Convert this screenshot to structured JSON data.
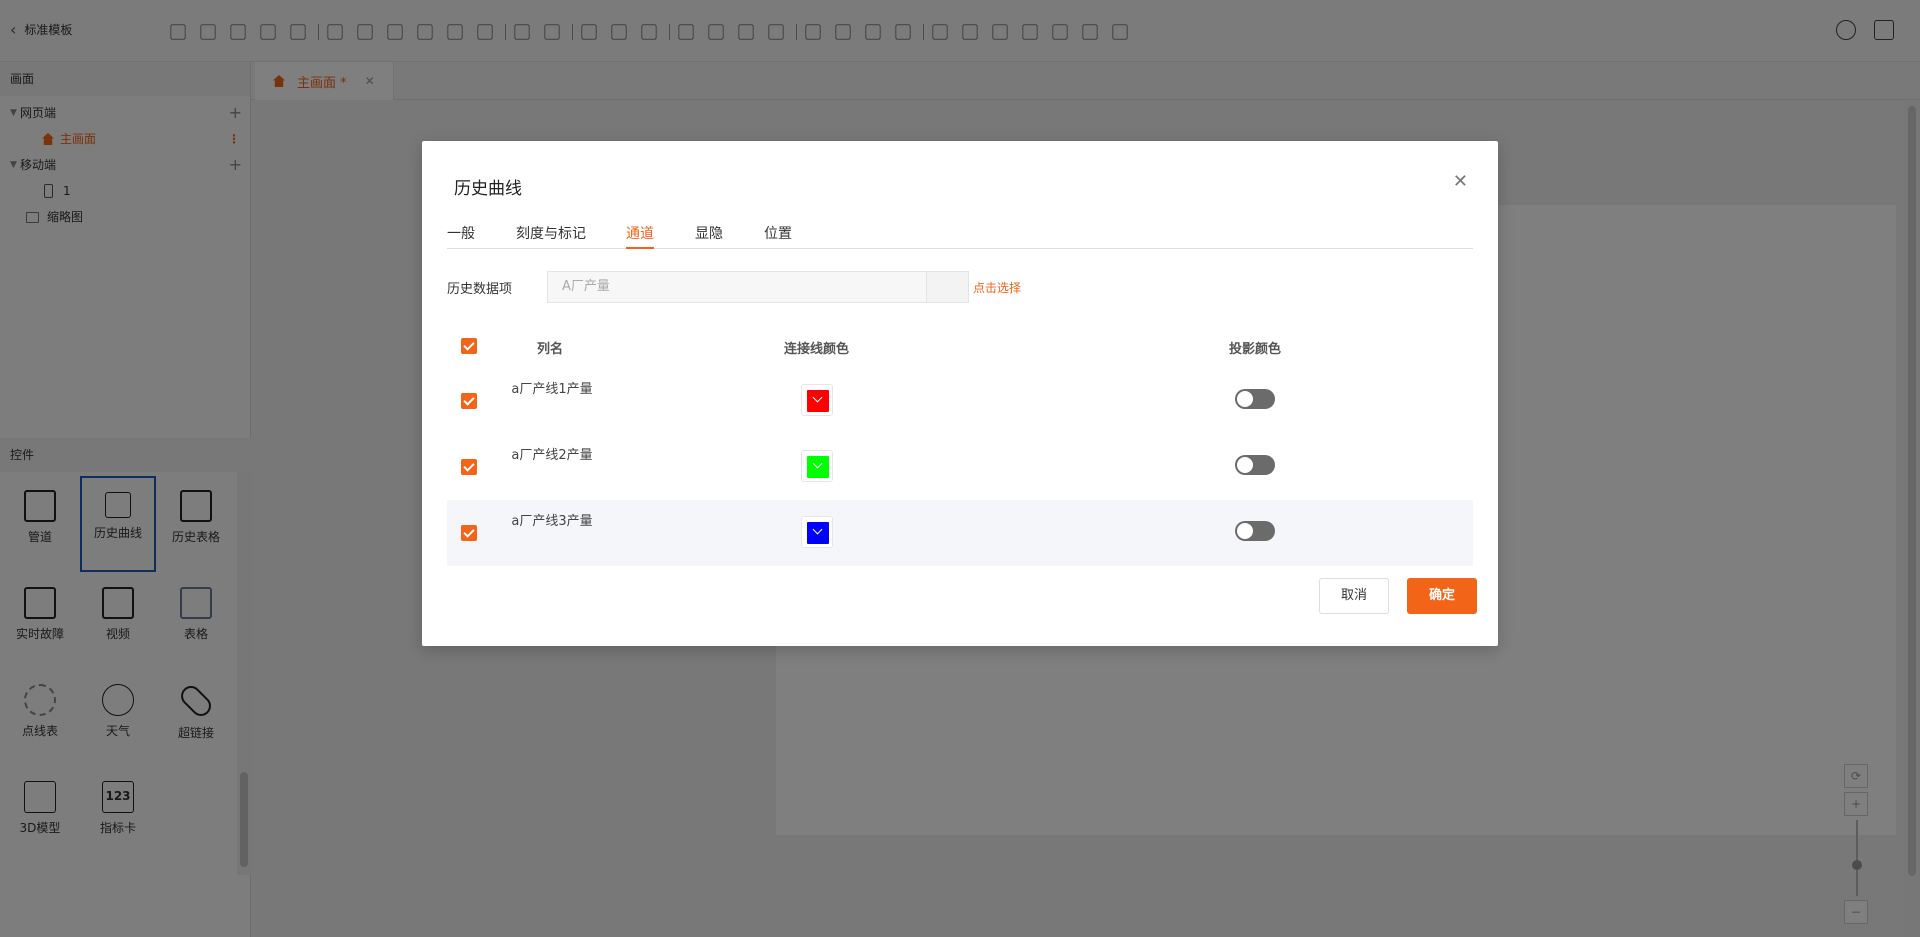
{
  "app": {
    "back_label": "标准模板"
  },
  "left_panel": {
    "pages_title": "画面",
    "tree": {
      "web_group": "网页端",
      "main_page": "主画面",
      "mobile_group": "移动端",
      "mobile_item": "1",
      "thumbnail": "缩略图"
    },
    "controls_title": "控件",
    "controls": [
      {
        "label": "管道",
        "icon": "pipe-icon"
      },
      {
        "label": "历史曲线",
        "icon": "history-curve-icon"
      },
      {
        "label": "历史表格",
        "icon": "history-table-icon"
      },
      {
        "label": "实时故障",
        "icon": "realtime-fault-icon"
      },
      {
        "label": "视频",
        "icon": "video-icon"
      },
      {
        "label": "表格",
        "icon": "table-icon"
      },
      {
        "label": "点线表",
        "icon": "dot-line-icon"
      },
      {
        "label": "天气",
        "icon": "weather-icon"
      },
      {
        "label": "超链接",
        "icon": "hyperlink-icon"
      },
      {
        "label": "3D模型",
        "icon": "cube-icon"
      },
      {
        "label": "指标卡",
        "icon": "indicator-card-icon",
        "glyph": "123"
      }
    ]
  },
  "editor": {
    "page_tab": "主画面 *"
  },
  "modal": {
    "title": "历史曲线",
    "tabs": [
      "一般",
      "刻度与标记",
      "通道",
      "显隐",
      "位置"
    ],
    "active_tab": "通道",
    "data_item_label": "历史数据项",
    "data_item_value": "A厂产量",
    "pick_link": "点击选择",
    "columns": {
      "name": "列名",
      "line_color": "连接线颜色",
      "shadow_color": "投影颜色"
    },
    "rows": [
      {
        "name": "a厂产线1产量",
        "checked": true,
        "line_color": "#ff0000",
        "shadow_on": false
      },
      {
        "name": "a厂产线2产量",
        "checked": true,
        "line_color": "#00ff00",
        "shadow_on": false
      },
      {
        "name": "a厂产线3产量",
        "checked": true,
        "line_color": "#0000ff",
        "shadow_on": false
      }
    ],
    "cancel_label": "取消",
    "ok_label": "确定"
  },
  "colors": {
    "accent": "#f26418",
    "selected_border": "#1a5bb5"
  }
}
